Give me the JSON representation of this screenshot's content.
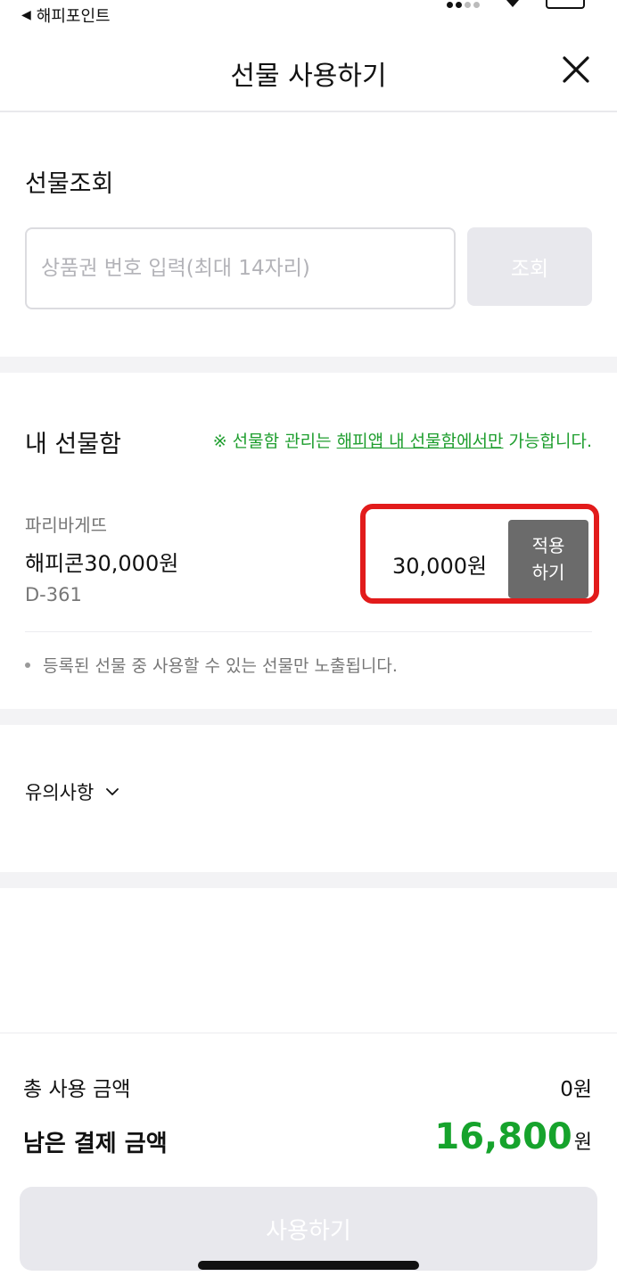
{
  "status_bar": {
    "back_app": "해피포인트"
  },
  "header": {
    "title": "선물 사용하기"
  },
  "gift_lookup": {
    "title": "선물조회",
    "input_placeholder": "상품권 번호 입력(최대 14자리)",
    "input_value": "",
    "button_label": "조회"
  },
  "gift_box": {
    "title": "내 선물함",
    "notice_prefix": "※ 선물함 관리는 ",
    "notice_link": "해피앱 내 선물함에서만",
    "notice_suffix": " 가능합니다.",
    "item": {
      "brand": "파리바게뜨",
      "name": "해피콘30,000원",
      "dday": "D-361",
      "amount": "30,000원",
      "apply_label_line1": "적용",
      "apply_label_line2": "하기"
    },
    "bullet_note": "등록된 선물 중 사용할 수 있는 선물만 노출됩니다."
  },
  "caution": {
    "label": "유의사항"
  },
  "summary": {
    "total_label": "총 사용 금액",
    "total_value": "0원",
    "remain_label": "남은 결제 금액",
    "remain_number": "16,800",
    "remain_unit": "원"
  },
  "footer": {
    "use_button_label": "사용하기"
  },
  "colors": {
    "accent_green": "#16a32c",
    "highlight_red": "#e21b1b",
    "disabled_button": "#e8e8ed",
    "apply_button": "#6b6b6b"
  }
}
